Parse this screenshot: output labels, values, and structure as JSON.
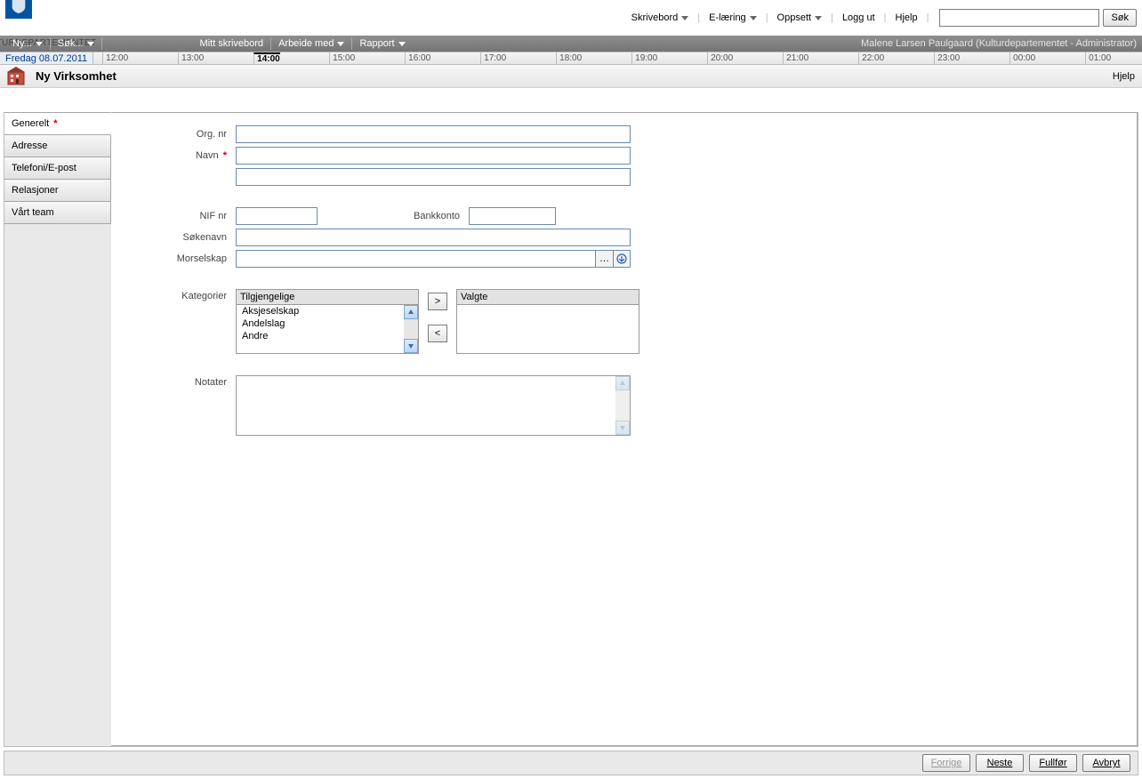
{
  "brand": "KULTURDEPARTEMENTET",
  "top_nav": {
    "skrivebord": "Skrivebord",
    "elaering": "E-læring",
    "oppsett": "Oppsett",
    "logg_ut": "Logg ut",
    "hjelp": "Hjelp",
    "search_button": "Søk"
  },
  "menubar": {
    "ny": "Ny...",
    "sok": "Søk...",
    "mitt": "Mitt skrivebord",
    "arbeide": "Arbeide med",
    "rapport": "Rapport",
    "user_context": "Malene Larsen Paulgaard (Kulturdepartementet - Administrator)"
  },
  "timeline": {
    "date": "Fredag 08.07.2011",
    "hours": [
      "12:00",
      "13:00",
      "14:00",
      "15:00",
      "16:00",
      "17:00",
      "18:00",
      "19:00",
      "20:00",
      "21:00",
      "22:00",
      "23:00",
      "00:00",
      "01:00"
    ],
    "active_index": 2
  },
  "page": {
    "title": "Ny Virksomhet",
    "help": "Hjelp"
  },
  "sidebar": {
    "generelt": "Generelt",
    "adresse": "Adresse",
    "telefoni": "Telefoni/E-post",
    "relasjoner": "Relasjoner",
    "team": "Vårt team"
  },
  "form": {
    "org_nr": "Org. nr",
    "navn": "Navn",
    "nif_nr": "NIF nr",
    "bankkonto": "Bankkonto",
    "sokenavn": "Søkenavn",
    "morselskap": "Morselskap",
    "kategorier": "Kategorier",
    "tilgjengelige": "Tilgjengelige",
    "valgte": "Valgte",
    "notater": "Notater",
    "available_items": [
      "Aksjeselskap",
      "Andelslag",
      "Andre"
    ]
  },
  "wizard": {
    "forrige": "Forrige",
    "neste": "Neste",
    "fullfor": "Fullfør",
    "avbryt": "Avbryt"
  }
}
